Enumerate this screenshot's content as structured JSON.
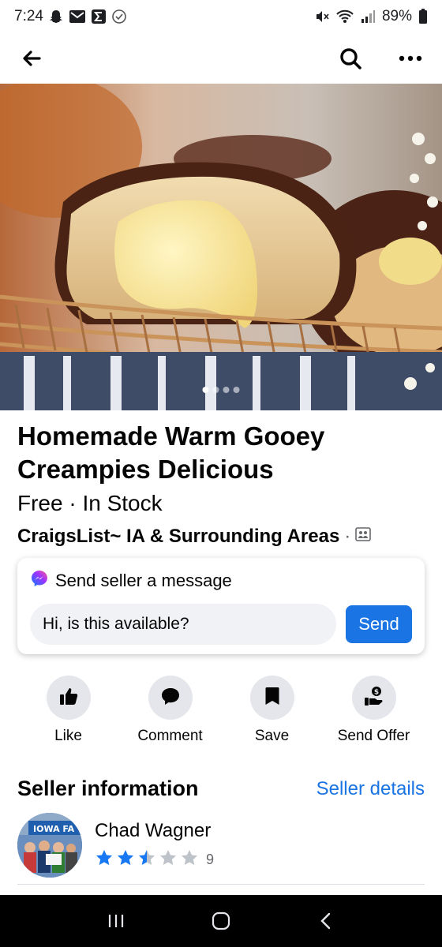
{
  "status_bar": {
    "time": "7:24",
    "battery": "89%",
    "left_icons": [
      "snapchat-icon",
      "mail-icon",
      "sigma-icon",
      "check-circle-icon"
    ],
    "right_icons": [
      "mute-icon",
      "wifi-icon",
      "signal-icon",
      "battery-icon"
    ]
  },
  "top_nav": {
    "back_icon": "arrow-left-icon",
    "search_icon": "search-icon",
    "more_icon": "more-horizontal-icon"
  },
  "hero": {
    "image_count": 4,
    "active_index": 0
  },
  "listing": {
    "title": "Homemade Warm Gooey Creampies Delicious",
    "price_stock": "Free · In Stock",
    "location": "CraigsList~ IA & Surrounding Areas",
    "location_separator": "·"
  },
  "message": {
    "header": "Send seller a message",
    "input_value": "Hi, is this available?",
    "send_label": "Send"
  },
  "actions": [
    {
      "label": "Like",
      "icon": "thumbs-up-icon"
    },
    {
      "label": "Comment",
      "icon": "comment-icon"
    },
    {
      "label": "Save",
      "icon": "bookmark-icon"
    },
    {
      "label": "Send Offer",
      "icon": "offer-icon"
    }
  ],
  "seller": {
    "section_title": "Seller information",
    "details_link": "Seller details",
    "name": "Chad Wagner",
    "rating": 2.5,
    "rating_max": 5,
    "rating_count": "9",
    "avatar_text": "IOWA FA"
  },
  "colors": {
    "accent": "#1b74e4",
    "star_filled": "#1877f2",
    "star_empty": "#bec3c9"
  }
}
